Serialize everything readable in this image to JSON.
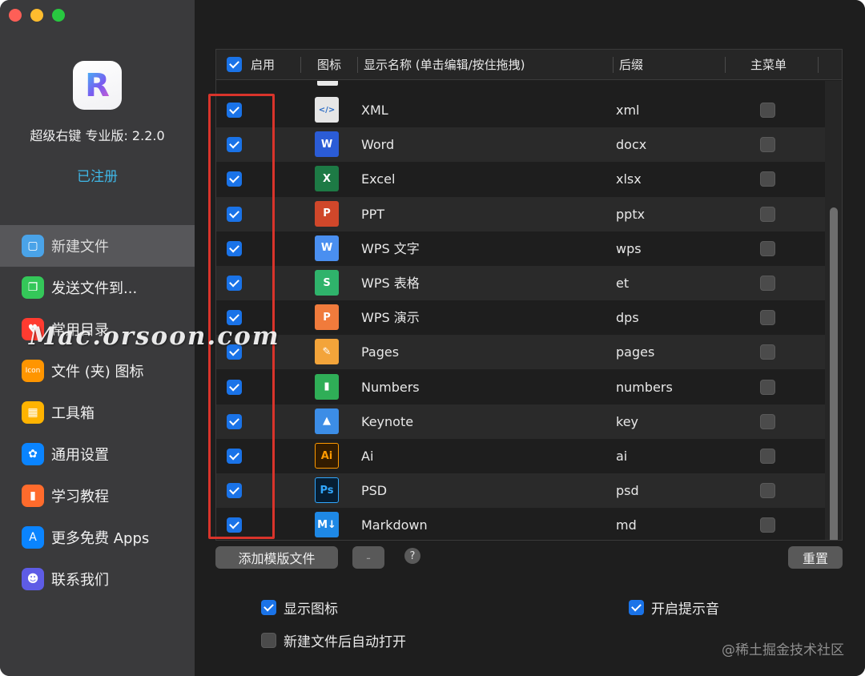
{
  "app": {
    "name": "超级右键 专业版: 2.2.0",
    "registered": "已注册",
    "icon_letter": "R"
  },
  "sidebar": {
    "items": [
      {
        "label": "新建文件",
        "icon": "new-file-icon",
        "color": "#4aa3e8",
        "active": true
      },
      {
        "label": "发送文件到...",
        "icon": "send-file-icon",
        "color": "#34c759",
        "active": false
      },
      {
        "label": "常用目录",
        "icon": "heart-icon",
        "color": "#ff3b30",
        "active": false
      },
      {
        "label": "文件 (夹) 图标",
        "icon": "icon-badge-icon",
        "color": "#ff9500",
        "active": false
      },
      {
        "label": "工具箱",
        "icon": "toolbox-icon",
        "color": "#ffb300",
        "active": false
      },
      {
        "label": "通用设置",
        "icon": "gear-icon",
        "color": "#0a84ff",
        "active": false
      },
      {
        "label": "学习教程",
        "icon": "book-icon",
        "color": "#ff6b2c",
        "active": false
      },
      {
        "label": "更多免费 Apps",
        "icon": "app-store-icon",
        "color": "#0a84ff",
        "active": false
      },
      {
        "label": "联系我们",
        "icon": "contacts-icon",
        "color": "#5e5ce6",
        "active": false
      }
    ]
  },
  "table": {
    "headers": {
      "enabled": "启用",
      "icon": "图标",
      "name": "显示名称 (单击编辑/按住拖拽)",
      "suffix": "后缀",
      "main_menu": "主菜单"
    },
    "rows": [
      {
        "name": "XML",
        "suffix": "xml",
        "enabled": true,
        "main": false,
        "icon": "xml-file-icon",
        "icon_text": "</>",
        "icon_color": "#e6e6e6"
      },
      {
        "name": "Word",
        "suffix": "docx",
        "enabled": true,
        "main": false,
        "icon": "word-icon",
        "icon_text": "W",
        "icon_color": "#2b5cd6"
      },
      {
        "name": "Excel",
        "suffix": "xlsx",
        "enabled": true,
        "main": false,
        "icon": "excel-icon",
        "icon_text": "X",
        "icon_color": "#1d7a45"
      },
      {
        "name": "PPT",
        "suffix": "pptx",
        "enabled": true,
        "main": false,
        "icon": "powerpoint-icon",
        "icon_text": "P",
        "icon_color": "#d0472a"
      },
      {
        "name": "WPS 文字",
        "suffix": "wps",
        "enabled": true,
        "main": false,
        "icon": "wps-writer-icon",
        "icon_text": "W",
        "icon_color": "#4a8ff0"
      },
      {
        "name": "WPS 表格",
        "suffix": "et",
        "enabled": true,
        "main": false,
        "icon": "wps-spreadsheet-icon",
        "icon_text": "S",
        "icon_color": "#2fb36b"
      },
      {
        "name": "WPS 演示",
        "suffix": "dps",
        "enabled": true,
        "main": false,
        "icon": "wps-presentation-icon",
        "icon_text": "P",
        "icon_color": "#f07b3c"
      },
      {
        "name": "Pages",
        "suffix": "pages",
        "enabled": true,
        "main": false,
        "icon": "pages-icon",
        "icon_text": "✎",
        "icon_color": "#f3a43a"
      },
      {
        "name": "Numbers",
        "suffix": "numbers",
        "enabled": true,
        "main": false,
        "icon": "numbers-icon",
        "icon_text": "▮",
        "icon_color": "#2fae57"
      },
      {
        "name": "Keynote",
        "suffix": "key",
        "enabled": true,
        "main": false,
        "icon": "keynote-icon",
        "icon_text": "▲",
        "icon_color": "#3c8de6"
      },
      {
        "name": "Ai",
        "suffix": "ai",
        "enabled": true,
        "main": false,
        "icon": "illustrator-icon",
        "icon_text": "Ai",
        "icon_color": "#331c00"
      },
      {
        "name": "PSD",
        "suffix": "psd",
        "enabled": true,
        "main": false,
        "icon": "photoshop-icon",
        "icon_text": "Ps",
        "icon_color": "#061e33"
      },
      {
        "name": "Markdown",
        "suffix": "md",
        "enabled": true,
        "main": false,
        "icon": "markdown-icon",
        "icon_text": "M↓",
        "icon_color": "#1e88e5"
      }
    ]
  },
  "buttons": {
    "add_template": "添加模版文件",
    "remove": "-",
    "help": "?",
    "reset": "重置"
  },
  "options": {
    "show_icons": {
      "label": "显示图标",
      "checked": true
    },
    "auto_open": {
      "label": "新建文件后自动打开",
      "checked": false
    },
    "sound": {
      "label": "开启提示音",
      "checked": true
    }
  },
  "overlay": {
    "watermark": "Mac.orsoon.com",
    "credit": "@稀土掘金技术社区"
  },
  "colors": {
    "accent": "#1a73e8",
    "highlight_box": "#d9342b",
    "registered": "#3fb8e8"
  }
}
